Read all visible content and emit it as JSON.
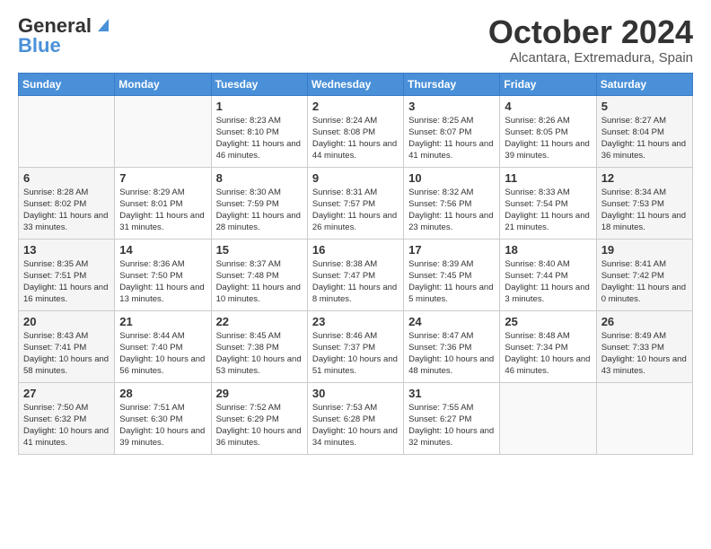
{
  "logo": {
    "general": "General",
    "blue": "Blue"
  },
  "header": {
    "month": "October 2024",
    "location": "Alcantara, Extremadura, Spain"
  },
  "days_of_week": [
    "Sunday",
    "Monday",
    "Tuesday",
    "Wednesday",
    "Thursday",
    "Friday",
    "Saturday"
  ],
  "weeks": [
    [
      {
        "day": "",
        "info": ""
      },
      {
        "day": "",
        "info": ""
      },
      {
        "day": "1",
        "info": "Sunrise: 8:23 AM\nSunset: 8:10 PM\nDaylight: 11 hours and 46 minutes."
      },
      {
        "day": "2",
        "info": "Sunrise: 8:24 AM\nSunset: 8:08 PM\nDaylight: 11 hours and 44 minutes."
      },
      {
        "day": "3",
        "info": "Sunrise: 8:25 AM\nSunset: 8:07 PM\nDaylight: 11 hours and 41 minutes."
      },
      {
        "day": "4",
        "info": "Sunrise: 8:26 AM\nSunset: 8:05 PM\nDaylight: 11 hours and 39 minutes."
      },
      {
        "day": "5",
        "info": "Sunrise: 8:27 AM\nSunset: 8:04 PM\nDaylight: 11 hours and 36 minutes."
      }
    ],
    [
      {
        "day": "6",
        "info": "Sunrise: 8:28 AM\nSunset: 8:02 PM\nDaylight: 11 hours and 33 minutes."
      },
      {
        "day": "7",
        "info": "Sunrise: 8:29 AM\nSunset: 8:01 PM\nDaylight: 11 hours and 31 minutes."
      },
      {
        "day": "8",
        "info": "Sunrise: 8:30 AM\nSunset: 7:59 PM\nDaylight: 11 hours and 28 minutes."
      },
      {
        "day": "9",
        "info": "Sunrise: 8:31 AM\nSunset: 7:57 PM\nDaylight: 11 hours and 26 minutes."
      },
      {
        "day": "10",
        "info": "Sunrise: 8:32 AM\nSunset: 7:56 PM\nDaylight: 11 hours and 23 minutes."
      },
      {
        "day": "11",
        "info": "Sunrise: 8:33 AM\nSunset: 7:54 PM\nDaylight: 11 hours and 21 minutes."
      },
      {
        "day": "12",
        "info": "Sunrise: 8:34 AM\nSunset: 7:53 PM\nDaylight: 11 hours and 18 minutes."
      }
    ],
    [
      {
        "day": "13",
        "info": "Sunrise: 8:35 AM\nSunset: 7:51 PM\nDaylight: 11 hours and 16 minutes."
      },
      {
        "day": "14",
        "info": "Sunrise: 8:36 AM\nSunset: 7:50 PM\nDaylight: 11 hours and 13 minutes."
      },
      {
        "day": "15",
        "info": "Sunrise: 8:37 AM\nSunset: 7:48 PM\nDaylight: 11 hours and 10 minutes."
      },
      {
        "day": "16",
        "info": "Sunrise: 8:38 AM\nSunset: 7:47 PM\nDaylight: 11 hours and 8 minutes."
      },
      {
        "day": "17",
        "info": "Sunrise: 8:39 AM\nSunset: 7:45 PM\nDaylight: 11 hours and 5 minutes."
      },
      {
        "day": "18",
        "info": "Sunrise: 8:40 AM\nSunset: 7:44 PM\nDaylight: 11 hours and 3 minutes."
      },
      {
        "day": "19",
        "info": "Sunrise: 8:41 AM\nSunset: 7:42 PM\nDaylight: 11 hours and 0 minutes."
      }
    ],
    [
      {
        "day": "20",
        "info": "Sunrise: 8:43 AM\nSunset: 7:41 PM\nDaylight: 10 hours and 58 minutes."
      },
      {
        "day": "21",
        "info": "Sunrise: 8:44 AM\nSunset: 7:40 PM\nDaylight: 10 hours and 56 minutes."
      },
      {
        "day": "22",
        "info": "Sunrise: 8:45 AM\nSunset: 7:38 PM\nDaylight: 10 hours and 53 minutes."
      },
      {
        "day": "23",
        "info": "Sunrise: 8:46 AM\nSunset: 7:37 PM\nDaylight: 10 hours and 51 minutes."
      },
      {
        "day": "24",
        "info": "Sunrise: 8:47 AM\nSunset: 7:36 PM\nDaylight: 10 hours and 48 minutes."
      },
      {
        "day": "25",
        "info": "Sunrise: 8:48 AM\nSunset: 7:34 PM\nDaylight: 10 hours and 46 minutes."
      },
      {
        "day": "26",
        "info": "Sunrise: 8:49 AM\nSunset: 7:33 PM\nDaylight: 10 hours and 43 minutes."
      }
    ],
    [
      {
        "day": "27",
        "info": "Sunrise: 7:50 AM\nSunset: 6:32 PM\nDaylight: 10 hours and 41 minutes."
      },
      {
        "day": "28",
        "info": "Sunrise: 7:51 AM\nSunset: 6:30 PM\nDaylight: 10 hours and 39 minutes."
      },
      {
        "day": "29",
        "info": "Sunrise: 7:52 AM\nSunset: 6:29 PM\nDaylight: 10 hours and 36 minutes."
      },
      {
        "day": "30",
        "info": "Sunrise: 7:53 AM\nSunset: 6:28 PM\nDaylight: 10 hours and 34 minutes."
      },
      {
        "day": "31",
        "info": "Sunrise: 7:55 AM\nSunset: 6:27 PM\nDaylight: 10 hours and 32 minutes."
      },
      {
        "day": "",
        "info": ""
      },
      {
        "day": "",
        "info": ""
      }
    ]
  ]
}
